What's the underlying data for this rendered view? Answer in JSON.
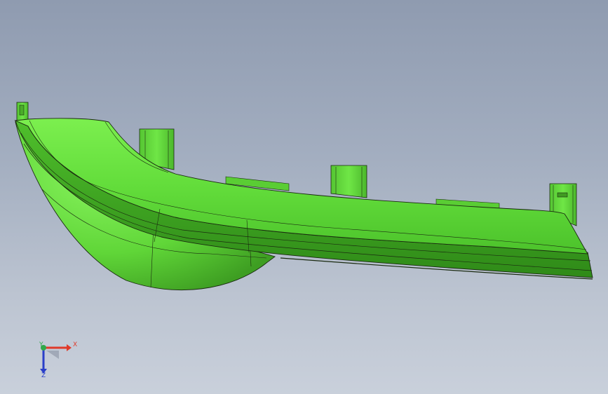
{
  "viewport": {
    "background_top": "#8f9bb0",
    "background_bottom": "#c9d0db"
  },
  "model": {
    "part_color": "#66e03c",
    "part_shade": "#3fa021",
    "edge_color": "#1a2a10"
  },
  "triad": {
    "x_label": "X",
    "y_label": "Y",
    "z_label": "Z",
    "x_color": "#e03a2a",
    "y_color": "#2fa84a",
    "z_color": "#2a3fc9"
  }
}
